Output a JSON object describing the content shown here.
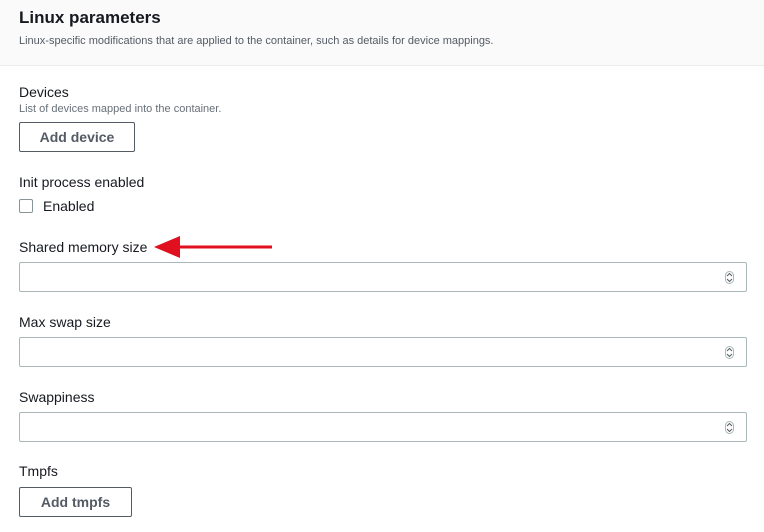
{
  "section": {
    "title": "Linux parameters",
    "description": "Linux-specific modifications that are applied to the container, such as details for device mappings."
  },
  "devices": {
    "label": "Devices",
    "description": "List of devices mapped into the container.",
    "button": "Add device"
  },
  "init_process": {
    "label": "Init process enabled",
    "checkbox_label": "Enabled",
    "checked": false
  },
  "shared_memory": {
    "label": "Shared memory size",
    "value": ""
  },
  "max_swap": {
    "label": "Max swap size",
    "value": ""
  },
  "swappiness": {
    "label": "Swappiness",
    "value": ""
  },
  "tmpfs": {
    "label": "Tmpfs",
    "button": "Add tmpfs"
  },
  "colors": {
    "annotation_arrow": "#e0101e"
  },
  "icons": {
    "stepper": "up-down-stepper-icon",
    "annotation": "red-arrow-icon"
  }
}
